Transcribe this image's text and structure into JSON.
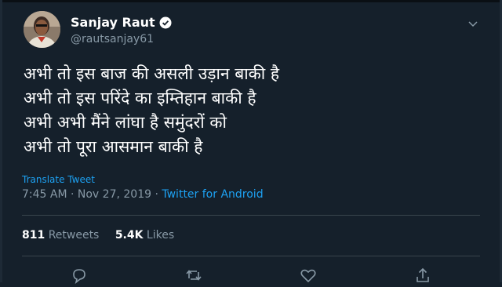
{
  "author": {
    "name": "Sanjay Raut",
    "handle": "@rautsanjay61",
    "verified": true
  },
  "tweet": {
    "lines": [
      "अभी तो इस बाज की असली उड़ान बाकी है",
      "अभी तो इस परिंदे का इम्तिहान बाकी है",
      "अभी अभी मैंने लांघा है समुंदरों को",
      "अभी तो पूरा आसमान बाकी है"
    ],
    "translate_label": "Translate Tweet",
    "timestamp": "7:45 AM · Nov 27, 2019 ·",
    "source": "Twitter for Android"
  },
  "stats": {
    "retweets_count": "811",
    "retweets_label": "Retweets",
    "likes_count": "5.4K",
    "likes_label": "Likes"
  },
  "icons": [
    "verified-icon",
    "chevron-down-icon",
    "reply-icon",
    "retweet-icon",
    "like-icon",
    "share-icon"
  ],
  "colors": {
    "background": "#15202b",
    "link": "#1da1f2",
    "muted": "#8899a6",
    "divider": "#38444d"
  }
}
